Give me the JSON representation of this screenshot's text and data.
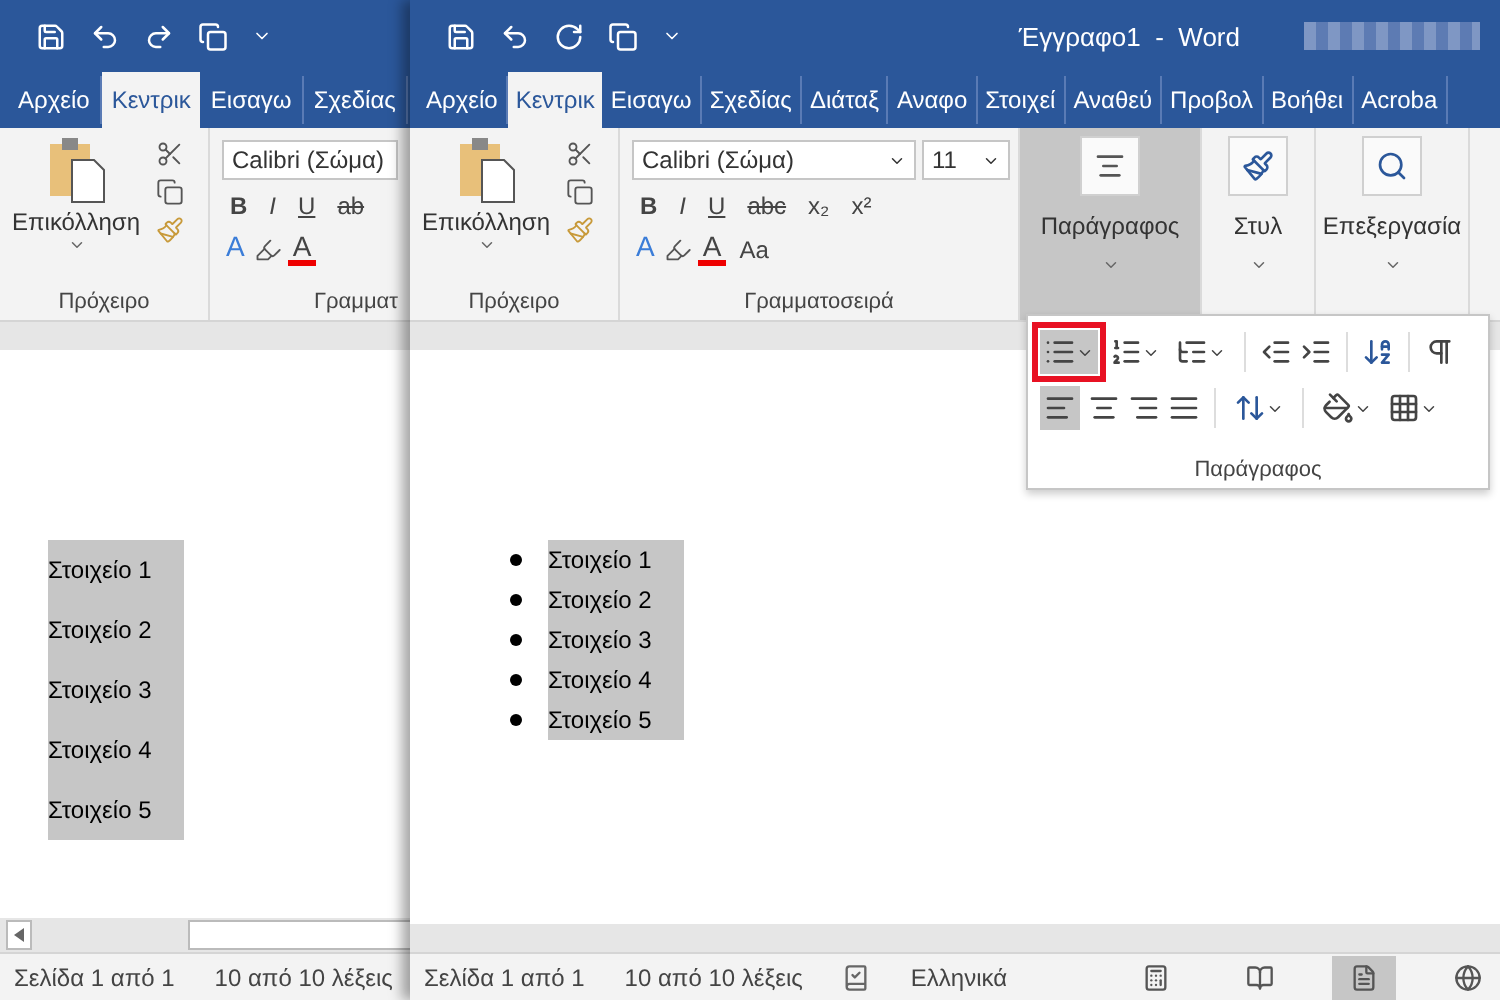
{
  "back_window": {
    "tabs": [
      {
        "label": "Αρχείο",
        "selected": false
      },
      {
        "label": "Κεντρικ",
        "selected": true
      },
      {
        "label": "Εισαγω",
        "selected": false
      },
      {
        "label": "Σχεδίας",
        "selected": false
      }
    ],
    "clipboard": {
      "paste": "Επικόλληση",
      "label": "Πρόχειρο"
    },
    "font": {
      "name": "Calibri (Σώμα)",
      "buttons": [
        "B",
        "I",
        "U",
        "ab"
      ],
      "effects": "A",
      "font_color_label": "A",
      "label": "Γραμματ"
    },
    "document": {
      "bulleted": false,
      "items": [
        "Στοιχείο 1",
        "Στοιχείο 2",
        "Στοιχείο 3",
        "Στοιχείο 4",
        "Στοιχείο 5"
      ]
    },
    "status_bar": {
      "page": "Σελίδα 1 από 1",
      "words": "10 από 10 λέξεις"
    }
  },
  "front_window": {
    "title": "Έγγραφο1  -  Word",
    "tabs": [
      {
        "label": "Αρχείο",
        "selected": false
      },
      {
        "label": "Κεντρικ",
        "selected": true
      },
      {
        "label": "Εισαγω",
        "selected": false
      },
      {
        "label": "Σχεδίας",
        "selected": false
      },
      {
        "label": "Διάταξ",
        "selected": false
      },
      {
        "label": "Αναφο",
        "selected": false
      },
      {
        "label": "Στοιχεί",
        "selected": false
      },
      {
        "label": "Αναθεύ",
        "selected": false
      },
      {
        "label": "Προβολ",
        "selected": false
      },
      {
        "label": "Βοήθει",
        "selected": false
      },
      {
        "label": "Acroba",
        "selected": false
      }
    ],
    "clipboard": {
      "paste": "Επικόλληση",
      "label": "Πρόχειρο"
    },
    "font": {
      "name": "Calibri (Σώμα)",
      "size": "11",
      "buttons": [
        "B",
        "I",
        "U",
        "abc",
        "x₂",
        "x²"
      ],
      "case": "Aa",
      "effects": "A",
      "font_color_label": "A",
      "label": "Γραμματοσειρά"
    },
    "collapsed_groups": [
      {
        "label": "Παράγραφος",
        "kind": "paragraph",
        "selected": true
      },
      {
        "label": "Στυλ",
        "kind": "styles",
        "selected": false
      },
      {
        "label": "Επεξεργασία",
        "kind": "editing",
        "selected": false
      }
    ],
    "paragraph_popup": {
      "label": "Παράγραφος",
      "bullets_selected": true,
      "align_left_selected": true
    },
    "document": {
      "bulleted": true,
      "items": [
        "Στοιχείο 1",
        "Στοιχείο 2",
        "Στοιχείο 3",
        "Στοιχείο 4",
        "Στοιχείο 5"
      ]
    },
    "status_bar": {
      "page": "Σελίδα 1 από 1",
      "words": "10 από 10 λέξεις",
      "language": "Ελληνικά",
      "views": [
        {
          "kind": "focus",
          "selected": false
        },
        {
          "kind": "read",
          "selected": false
        },
        {
          "kind": "print",
          "selected": true
        },
        {
          "kind": "web",
          "selected": false
        }
      ]
    }
  }
}
